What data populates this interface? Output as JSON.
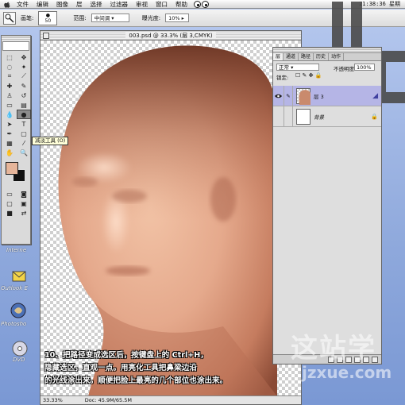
{
  "menubar": {
    "items": [
      "文件",
      "编辑",
      "图像",
      "层",
      "选择",
      "过滤器",
      "审视",
      "窗口",
      "帮助"
    ],
    "clock": "21:38:36 星期"
  },
  "options": {
    "brush_label": "画笔:",
    "brush_size": "50",
    "mode_label": "范围:",
    "mode_value": "中间调",
    "exposure_label": "曝光度:",
    "exposure_value": "10%"
  },
  "document": {
    "title": "003.psd @ 33.3% (层 3,CMYK)",
    "zoom": "33.33%",
    "doc_info": "Doc: 45.9M/65.5M"
  },
  "tooltip": "减淡工具 (O)",
  "layers": {
    "tabs": [
      "层",
      "通道",
      "路径",
      "历史",
      "动作"
    ],
    "blend_mode": "正常",
    "opacity_label": "不透明度:",
    "opacity_value": "100%",
    "lock_label": "锁定:",
    "rows": [
      {
        "name": "层 3",
        "selected": true
      },
      {
        "name": "背景",
        "selected": false
      }
    ]
  },
  "desktop": {
    "label_internet": "Interne",
    "label_outlook": "Outlook E",
    "label_photoshop": "Photosho",
    "label_dvd": "DVD"
  },
  "caption": {
    "line1": "10、把路径变成选区后，按键盘上的 Ctrl+H，",
    "line2": "隐藏选区，直观一点。用亮化工具把鼻梁边沿",
    "line3": "的光线涂出来。顺便把脸上最亮的几个部位也涂出来。"
  },
  "watermark": {
    "cn": "这站学",
    "en": "jzxue.com"
  },
  "colors": {
    "foreground": "#e6b59a",
    "background": "#111111",
    "skin_light": "#e5a98c",
    "skin_dark": "#6b3524"
  }
}
